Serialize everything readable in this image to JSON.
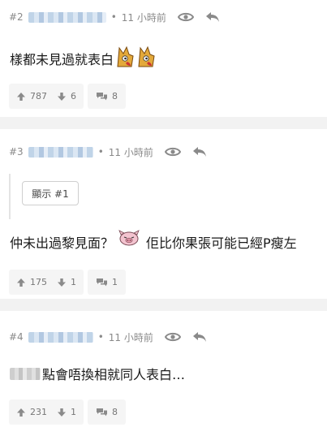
{
  "posts": [
    {
      "number": "#2",
      "time": "11 小時前",
      "text": "樣都未見過就表白",
      "upvotes": "787",
      "downvotes": "6",
      "replies": "8"
    },
    {
      "number": "#3",
      "time": "11 小時前",
      "quote_button": "顯示 #1",
      "text_a": "仲未出過黎見面？",
      "text_b": "佢比你果張可能已經P瘦左",
      "upvotes": "175",
      "downvotes": "1",
      "replies": "1"
    },
    {
      "number": "#4",
      "time": "11 小時前",
      "text": "點會唔換相就同人表白…",
      "upvotes": "231",
      "downvotes": "1",
      "replies": "8"
    }
  ],
  "meta_separator": "•",
  "icons": {
    "view": "eye-icon",
    "reply": "reply-arrow-icon",
    "upvote": "arrow-up-icon",
    "downvote": "arrow-down-icon",
    "comments": "chat-bubbles-icon"
  },
  "colors": {
    "page_bg": "#f2f2f2",
    "card_bg": "#ffffff",
    "meta_text": "#8a8a8a",
    "pill_bg": "#f5f5f5"
  }
}
